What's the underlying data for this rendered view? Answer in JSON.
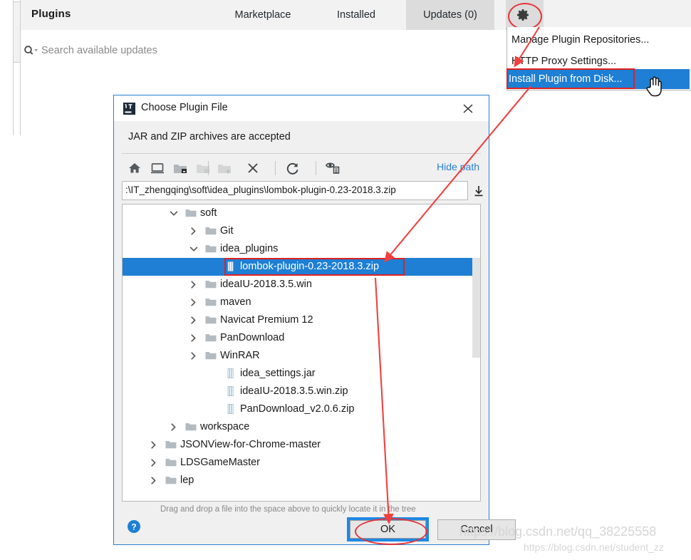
{
  "app": {
    "header_title": "Plugins",
    "tabs": [
      {
        "label": "Marketplace",
        "selected": false
      },
      {
        "label": "Installed",
        "selected": false
      },
      {
        "label": "Updates (0)",
        "selected": true
      }
    ],
    "gear_icon": "gear-icon",
    "search": {
      "icon": "search-icon",
      "placeholder": "Search available updates"
    }
  },
  "gear_menu": {
    "items": [
      {
        "label": "Manage Plugin Repositories...",
        "highlighted": false
      },
      {
        "label": "HTTP Proxy Settings...",
        "highlighted": false
      },
      {
        "label": "Install Plugin from Disk...",
        "highlighted": true
      }
    ]
  },
  "dialog": {
    "icon": "intellij-idea-icon",
    "title": "Choose Plugin File",
    "close_icon": "close-icon",
    "subtitle": "JAR and ZIP archives are accepted",
    "toolbar": {
      "buttons": [
        {
          "name": "home-icon",
          "enabled": true
        },
        {
          "name": "desktop-icon",
          "enabled": true
        },
        {
          "name": "project-folder-icon",
          "enabled": true
        },
        {
          "name": "module-folder-icon",
          "enabled": false
        },
        {
          "name": "new-folder-icon",
          "enabled": false
        },
        {
          "name": "delete-icon",
          "enabled": true
        },
        {
          "name": "refresh-icon",
          "enabled": true
        },
        {
          "name": "show-hidden-files-icon",
          "enabled": true
        }
      ],
      "hide_path_label": "Hide path"
    },
    "path_field": {
      "value": ":\\IT_zhengqing\\soft\\idea_plugins\\lombok-plugin-0.23-2018.3.zip",
      "expand_icon": "expand-path-icon"
    },
    "tree": [
      {
        "label": "soft",
        "indent": 2,
        "state": "expanded",
        "icon": "folder-icon",
        "selected": false
      },
      {
        "label": "Git",
        "indent": 3,
        "state": "collapsed",
        "icon": "folder-icon",
        "selected": false
      },
      {
        "label": "idea_plugins",
        "indent": 3,
        "state": "expanded",
        "icon": "folder-icon",
        "selected": false
      },
      {
        "label": "lombok-plugin-0.23-2018.3.zip",
        "indent": 4,
        "state": "leaf",
        "icon": "zip-file-icon",
        "selected": true
      },
      {
        "label": "ideaIU-2018.3.5.win",
        "indent": 3,
        "state": "collapsed",
        "icon": "folder-icon",
        "selected": false
      },
      {
        "label": "maven",
        "indent": 3,
        "state": "collapsed",
        "icon": "folder-icon",
        "selected": false
      },
      {
        "label": "Navicat Premium 12",
        "indent": 3,
        "state": "collapsed",
        "icon": "folder-icon",
        "selected": false
      },
      {
        "label": "PanDownload",
        "indent": 3,
        "state": "collapsed",
        "icon": "folder-icon",
        "selected": false
      },
      {
        "label": "WinRAR",
        "indent": 3,
        "state": "collapsed",
        "icon": "folder-icon",
        "selected": false
      },
      {
        "label": "idea_settings.jar",
        "indent": 4,
        "state": "leaf",
        "icon": "jar-file-icon",
        "selected": false
      },
      {
        "label": "ideaIU-2018.3.5.win.zip",
        "indent": 4,
        "state": "leaf",
        "icon": "zip-file-icon",
        "selected": false
      },
      {
        "label": "PanDownload_v2.0.6.zip",
        "indent": 4,
        "state": "leaf",
        "icon": "zip-file-icon",
        "selected": false
      },
      {
        "label": "workspace",
        "indent": 2,
        "state": "collapsed",
        "icon": "folder-icon",
        "selected": false
      },
      {
        "label": "JSONView-for-Chrome-master",
        "indent": 1,
        "state": "collapsed",
        "icon": "folder-icon",
        "selected": false
      },
      {
        "label": "LDSGameMaster",
        "indent": 1,
        "state": "collapsed",
        "icon": "folder-icon",
        "selected": false
      },
      {
        "label": "lep",
        "indent": 1,
        "state": "collapsed",
        "icon": "folder-icon",
        "selected": false
      }
    ],
    "drag_hint": "Drag and drop a file into the space above to quickly locate it in the tree",
    "help_icon": "help-icon",
    "ok_label": "OK",
    "cancel_label": "Cancel"
  },
  "watermarks": {
    "line1": "https://blog.csdn.net/qq_38225558",
    "line2": "https://blog.csdn.net/student_zz"
  },
  "colors": {
    "accent_blue": "#1e7fd4",
    "annotation_red": "#e5353a",
    "link_blue": "#2a7fd4",
    "dialog_border": "#2b7fd0"
  }
}
